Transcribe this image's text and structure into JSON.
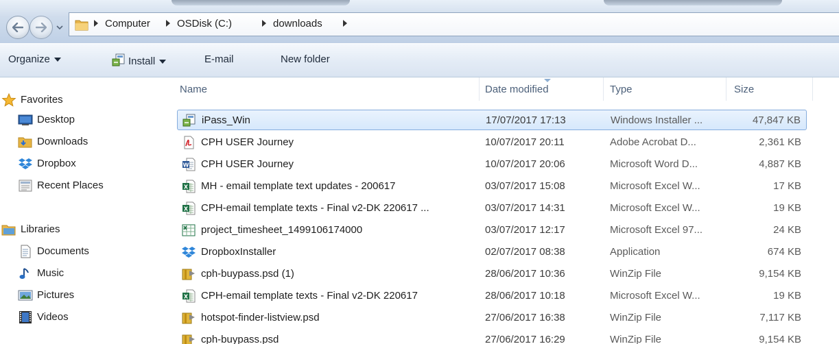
{
  "address_bar": {
    "crumbs": [
      "Computer",
      "OSDisk (C:)",
      "downloads"
    ]
  },
  "toolbar": {
    "organize_label": "Organize",
    "install_label": "Install",
    "email_label": "E-mail",
    "new_folder_label": "New folder"
  },
  "nav": {
    "favorites_label": "Favorites",
    "favorites": [
      {
        "label": "Desktop",
        "icon": "desktop-icon"
      },
      {
        "label": "Downloads",
        "icon": "downloads-folder-icon"
      },
      {
        "label": "Dropbox",
        "icon": "dropbox-icon"
      },
      {
        "label": "Recent Places",
        "icon": "recent-places-icon"
      }
    ],
    "libraries_label": "Libraries",
    "libraries": [
      {
        "label": "Documents",
        "icon": "documents-icon"
      },
      {
        "label": "Music",
        "icon": "music-icon"
      },
      {
        "label": "Pictures",
        "icon": "pictures-icon"
      },
      {
        "label": "Videos",
        "icon": "videos-icon"
      }
    ]
  },
  "columns": {
    "name": "Name",
    "date": "Date modified",
    "type": "Type",
    "size": "Size"
  },
  "files": [
    {
      "name": "iPass_Win",
      "date": "17/07/2017 17:13",
      "type": "Windows Installer ...",
      "size": "47,847 KB",
      "icon": "installer-icon",
      "selected": true
    },
    {
      "name": "CPH USER Journey",
      "date": "10/07/2017 20:11",
      "type": "Adobe Acrobat D...",
      "size": "2,361 KB",
      "icon": "pdf-icon"
    },
    {
      "name": "CPH USER Journey",
      "date": "10/07/2017 20:06",
      "type": "Microsoft Word D...",
      "size": "4,887 KB",
      "icon": "word-doc-icon"
    },
    {
      "name": "MH - email template text updates - 200617",
      "date": "03/07/2017 15:08",
      "type": "Microsoft Excel W...",
      "size": "17 KB",
      "icon": "excel-icon"
    },
    {
      "name": "CPH-email template texts - Final v2-DK 220617 ...",
      "date": "03/07/2017 14:31",
      "type": "Microsoft Excel W...",
      "size": "19 KB",
      "icon": "excel-icon"
    },
    {
      "name": "project_timesheet_1499106174000",
      "date": "03/07/2017 12:17",
      "type": "Microsoft Excel 97...",
      "size": "24 KB",
      "icon": "excel97-icon"
    },
    {
      "name": "DropboxInstaller",
      "date": "02/07/2017 08:38",
      "type": "Application",
      "size": "674 KB",
      "icon": "dropbox-icon"
    },
    {
      "name": "cph-buypass.psd (1)",
      "date": "28/06/2017 10:36",
      "type": "WinZip File",
      "size": "9,154 KB",
      "icon": "winzip-icon"
    },
    {
      "name": "CPH-email template texts - Final v2-DK 220617",
      "date": "28/06/2017 10:18",
      "type": "Microsoft Excel W...",
      "size": "19 KB",
      "icon": "excel-icon"
    },
    {
      "name": "hotspot-finder-listview.psd",
      "date": "27/06/2017 16:38",
      "type": "WinZip File",
      "size": "7,117 KB",
      "icon": "winzip-icon"
    },
    {
      "name": "cph-buypass.psd",
      "date": "27/06/2017 16:29",
      "type": "WinZip File",
      "size": "9,154 KB",
      "icon": "winzip-icon"
    }
  ]
}
